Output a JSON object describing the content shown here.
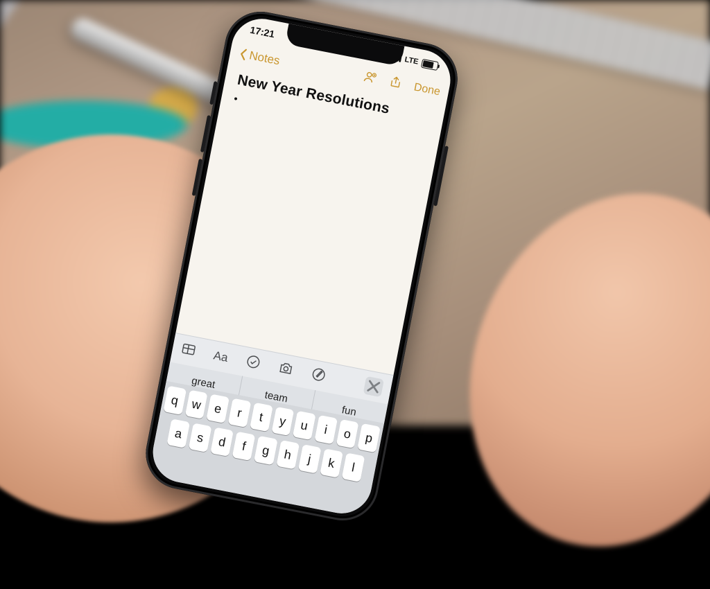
{
  "status": {
    "time": "17:21",
    "network": "LTE"
  },
  "nav": {
    "back_label": "Notes",
    "done_label": "Done"
  },
  "note": {
    "title": "New Year Resolutions",
    "bullet": "•"
  },
  "toolbar": {
    "text_style_label": "Aa"
  },
  "predictive": {
    "s1": "great",
    "s2": "team",
    "s3": "fun"
  },
  "keyboard": {
    "row1": [
      "q",
      "w",
      "e",
      "r",
      "t",
      "y",
      "u",
      "i",
      "o",
      "p"
    ],
    "row2": [
      "a",
      "s",
      "d",
      "f",
      "g",
      "h",
      "j",
      "k",
      "l"
    ]
  }
}
